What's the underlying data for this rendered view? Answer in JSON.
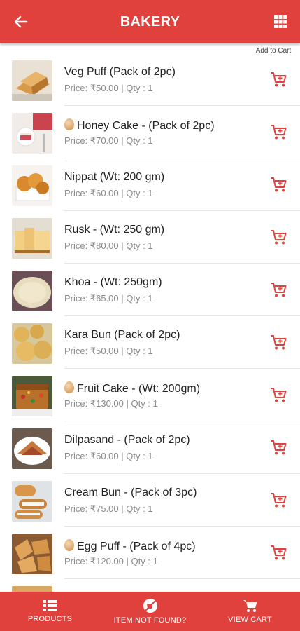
{
  "header": {
    "title": "BAKERY",
    "back_icon": "arrow-left-icon",
    "menu_icon": "grid-icon",
    "color": "#e0413d"
  },
  "add_to_cart_header": "Add to Cart",
  "products": [
    {
      "name": "Veg Puff (Pack of 2pc)",
      "egg": false,
      "meta": "Price: ₹50.00 | Qty : 1"
    },
    {
      "name": "Honey Cake - (Pack of 2pc)",
      "egg": true,
      "meta": "Price: ₹70.00 | Qty : 1"
    },
    {
      "name": "Nippat (Wt: 200 gm)",
      "egg": false,
      "meta": "Price: ₹60.00 | Qty : 1"
    },
    {
      "name": "Rusk - (Wt: 250 gm)",
      "egg": false,
      "meta": "Price: ₹80.00 | Qty : 1"
    },
    {
      "name": "Khoa - (Wt: 250gm)",
      "egg": false,
      "meta": "Price: ₹65.00 | Qty : 1"
    },
    {
      "name": "Kara Bun (Pack of 2pc)",
      "egg": false,
      "meta": "Price: ₹50.00 | Qty : 1"
    },
    {
      "name": "Fruit Cake - (Wt: 200gm)",
      "egg": true,
      "meta": "Price: ₹130.00 | Qty : 1"
    },
    {
      "name": "Dilpasand - (Pack of 2pc)",
      "egg": false,
      "meta": "Price: ₹60.00 | Qty : 1"
    },
    {
      "name": "Cream Bun - (Pack of 3pc)",
      "egg": false,
      "meta": "Price: ₹75.00 | Qty : 1"
    },
    {
      "name": "Egg Puff - (Pack of 4pc)",
      "egg": true,
      "meta": "Price: ₹120.00 | Qty : 1"
    }
  ],
  "bottom_nav": [
    {
      "label": "PRODUCTS",
      "icon": "list-icon"
    },
    {
      "label": "ITEM NOT FOUND?",
      "icon": "not-found-icon"
    },
    {
      "label": "VIEW CART",
      "icon": "cart-icon"
    }
  ]
}
